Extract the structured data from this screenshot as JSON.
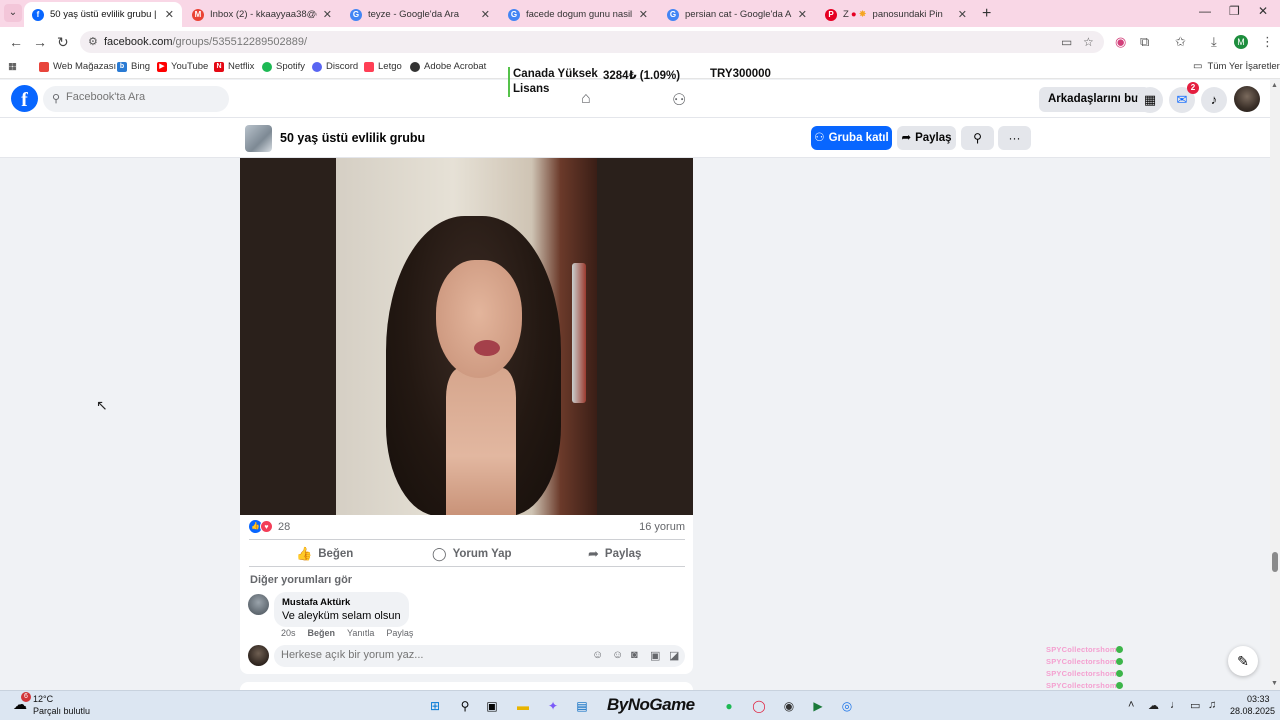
{
  "browser": {
    "tabs": [
      {
        "title": "50 yaş üstü evlilik grubu | Faceb",
        "icon": "facebook-icon",
        "active": true
      },
      {
        "title": "Inbox (2) - kkaayyaa38@gmail.c",
        "icon": "gmail-icon"
      },
      {
        "title": "teyze - Google'da Ara",
        "icon": "google-icon"
      },
      {
        "title": "facede dogum gunu nasil degis",
        "icon": "google-icon"
      },
      {
        "title": "persian cat - Google'da Ara",
        "icon": "google-icon"
      },
      {
        "title": "panosundaki Pin",
        "icon": "pinterest-icon",
        "prefix": "Z"
      }
    ],
    "url_host": "facebook.com",
    "url_path": "/groups/535512289502889/",
    "profile_initial": "M",
    "bookmarks": [
      {
        "label": "Web Mağazası",
        "color": "#e8453c"
      },
      {
        "label": "Bing",
        "color": "#2a7bd4"
      },
      {
        "label": "YouTube",
        "color": "#ff0000"
      },
      {
        "label": "Netflix",
        "color": "#e50914"
      },
      {
        "label": "Spotify",
        "color": "#1db954"
      },
      {
        "label": "Discord",
        "color": "#5865f2"
      },
      {
        "label": "Letgo",
        "color": "#ff3f55"
      },
      {
        "label": "Adobe Acrobat",
        "color": "#333333"
      }
    ],
    "all_bookmarks": "Tüm Yer İşaretleri"
  },
  "overlay": {
    "text": "Canada Yüksek Lisans",
    "value1": "3284₺ (1.09%)",
    "value2": "TRY300000"
  },
  "fb": {
    "search_placeholder": "Facebook'ta Ara",
    "find_friends": "Arkadaşlarını bul",
    "messenger_badge": "2",
    "group_name": "50 yaş üstü evlilik grubu",
    "join_label": "Gruba katıl",
    "share_label": "Paylaş"
  },
  "post": {
    "reaction_count": "28",
    "comment_count": "16 yorum",
    "like_label": "Beğen",
    "comment_label": "Yorum Yap",
    "share_label": "Paylaş",
    "more_comments": "Diğer yorumları gör",
    "comment": {
      "author": "Mustafa Aktürk",
      "text": "Ve aleyküm selam olsun",
      "time": "20s",
      "like": "Beğen",
      "reply": "Yanıtla",
      "share": "Paylaş"
    },
    "write_placeholder": "Herkese açık bir yorum yaz..."
  },
  "watermark": [
    "SPYCollectorshome",
    "SPYCollectorshome",
    "SPYCollectorshome",
    "SPYCollectorshome",
    "SPYCollectorshome"
  ],
  "taskbar": {
    "weather_badge": "6",
    "temperature": "12°C",
    "condition": "Parçalı bulutlu",
    "brand": "ByNoGame",
    "time": "03:33",
    "date": "28.08.2025"
  },
  "colors": {
    "fb_blue": "#0866ff",
    "tabbar": "#f9d7e6"
  }
}
